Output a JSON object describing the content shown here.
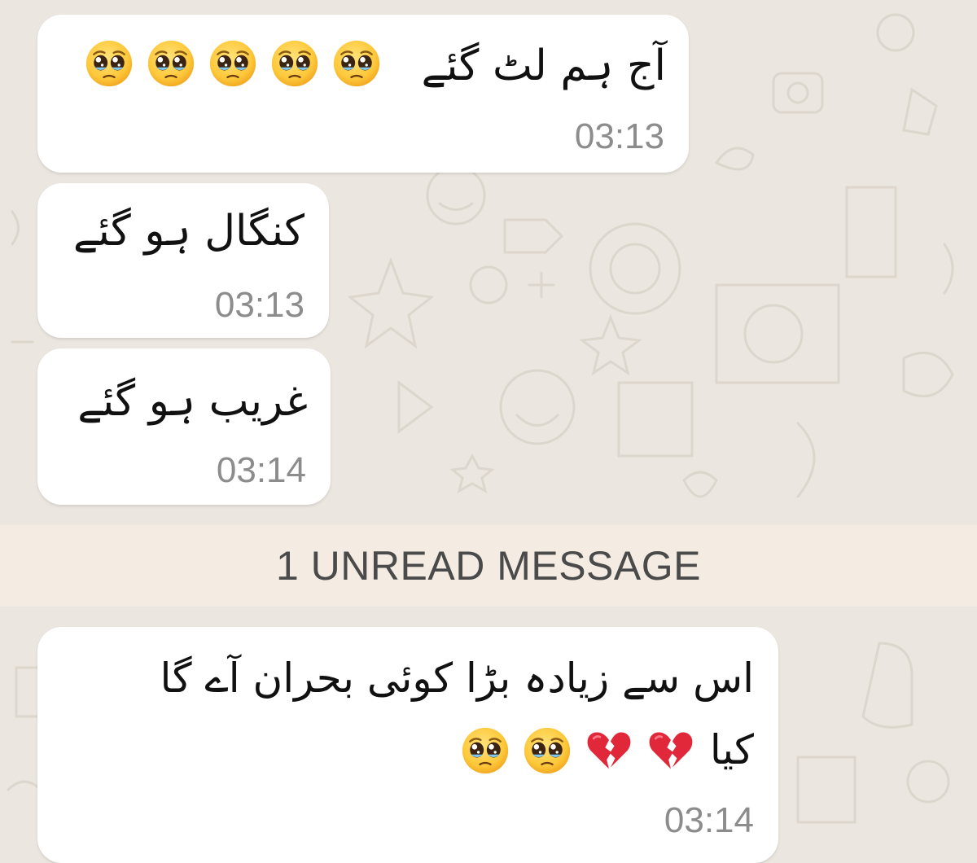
{
  "unread": {
    "label": "1 UNREAD MESSAGE"
  },
  "messages": [
    {
      "text": "آج ہم لٹ گئے",
      "time": "03:13"
    },
    {
      "text": "کنگال ہو گئے",
      "time": "03:13"
    },
    {
      "text": "غریب ہو گئے",
      "time": "03:14"
    },
    {
      "line1": "اس سے زیادہ بڑا کوئی بحران آے گا",
      "line2": "کیا",
      "time": "03:14"
    }
  ],
  "emoji": {
    "pleading": "pleading-face-icon",
    "broken_heart": "broken-heart-icon"
  },
  "colors": {
    "background": "#ebe6df",
    "bubble": "#ffffff",
    "time": "#8c8c8c",
    "unread_bar": "#f4ece2",
    "broken_heart": "#e0283a"
  }
}
